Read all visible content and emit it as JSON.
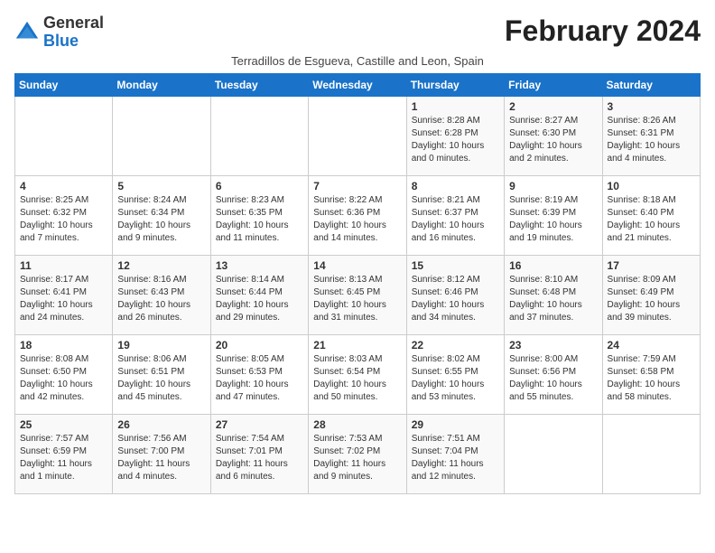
{
  "logo": {
    "general": "General",
    "blue": "Blue"
  },
  "header": {
    "month_title": "February 2024",
    "subtitle": "Terradillos de Esgueva, Castille and Leon, Spain"
  },
  "days_of_week": [
    "Sunday",
    "Monday",
    "Tuesday",
    "Wednesday",
    "Thursday",
    "Friday",
    "Saturday"
  ],
  "weeks": [
    [
      {
        "day": "",
        "info": ""
      },
      {
        "day": "",
        "info": ""
      },
      {
        "day": "",
        "info": ""
      },
      {
        "day": "",
        "info": ""
      },
      {
        "day": "1",
        "info": "Sunrise: 8:28 AM\nSunset: 6:28 PM\nDaylight: 10 hours and 0 minutes."
      },
      {
        "day": "2",
        "info": "Sunrise: 8:27 AM\nSunset: 6:30 PM\nDaylight: 10 hours and 2 minutes."
      },
      {
        "day": "3",
        "info": "Sunrise: 8:26 AM\nSunset: 6:31 PM\nDaylight: 10 hours and 4 minutes."
      }
    ],
    [
      {
        "day": "4",
        "info": "Sunrise: 8:25 AM\nSunset: 6:32 PM\nDaylight: 10 hours and 7 minutes."
      },
      {
        "day": "5",
        "info": "Sunrise: 8:24 AM\nSunset: 6:34 PM\nDaylight: 10 hours and 9 minutes."
      },
      {
        "day": "6",
        "info": "Sunrise: 8:23 AM\nSunset: 6:35 PM\nDaylight: 10 hours and 11 minutes."
      },
      {
        "day": "7",
        "info": "Sunrise: 8:22 AM\nSunset: 6:36 PM\nDaylight: 10 hours and 14 minutes."
      },
      {
        "day": "8",
        "info": "Sunrise: 8:21 AM\nSunset: 6:37 PM\nDaylight: 10 hours and 16 minutes."
      },
      {
        "day": "9",
        "info": "Sunrise: 8:19 AM\nSunset: 6:39 PM\nDaylight: 10 hours and 19 minutes."
      },
      {
        "day": "10",
        "info": "Sunrise: 8:18 AM\nSunset: 6:40 PM\nDaylight: 10 hours and 21 minutes."
      }
    ],
    [
      {
        "day": "11",
        "info": "Sunrise: 8:17 AM\nSunset: 6:41 PM\nDaylight: 10 hours and 24 minutes."
      },
      {
        "day": "12",
        "info": "Sunrise: 8:16 AM\nSunset: 6:43 PM\nDaylight: 10 hours and 26 minutes."
      },
      {
        "day": "13",
        "info": "Sunrise: 8:14 AM\nSunset: 6:44 PM\nDaylight: 10 hours and 29 minutes."
      },
      {
        "day": "14",
        "info": "Sunrise: 8:13 AM\nSunset: 6:45 PM\nDaylight: 10 hours and 31 minutes."
      },
      {
        "day": "15",
        "info": "Sunrise: 8:12 AM\nSunset: 6:46 PM\nDaylight: 10 hours and 34 minutes."
      },
      {
        "day": "16",
        "info": "Sunrise: 8:10 AM\nSunset: 6:48 PM\nDaylight: 10 hours and 37 minutes."
      },
      {
        "day": "17",
        "info": "Sunrise: 8:09 AM\nSunset: 6:49 PM\nDaylight: 10 hours and 39 minutes."
      }
    ],
    [
      {
        "day": "18",
        "info": "Sunrise: 8:08 AM\nSunset: 6:50 PM\nDaylight: 10 hours and 42 minutes."
      },
      {
        "day": "19",
        "info": "Sunrise: 8:06 AM\nSunset: 6:51 PM\nDaylight: 10 hours and 45 minutes."
      },
      {
        "day": "20",
        "info": "Sunrise: 8:05 AM\nSunset: 6:53 PM\nDaylight: 10 hours and 47 minutes."
      },
      {
        "day": "21",
        "info": "Sunrise: 8:03 AM\nSunset: 6:54 PM\nDaylight: 10 hours and 50 minutes."
      },
      {
        "day": "22",
        "info": "Sunrise: 8:02 AM\nSunset: 6:55 PM\nDaylight: 10 hours and 53 minutes."
      },
      {
        "day": "23",
        "info": "Sunrise: 8:00 AM\nSunset: 6:56 PM\nDaylight: 10 hours and 55 minutes."
      },
      {
        "day": "24",
        "info": "Sunrise: 7:59 AM\nSunset: 6:58 PM\nDaylight: 10 hours and 58 minutes."
      }
    ],
    [
      {
        "day": "25",
        "info": "Sunrise: 7:57 AM\nSunset: 6:59 PM\nDaylight: 11 hours and 1 minute."
      },
      {
        "day": "26",
        "info": "Sunrise: 7:56 AM\nSunset: 7:00 PM\nDaylight: 11 hours and 4 minutes."
      },
      {
        "day": "27",
        "info": "Sunrise: 7:54 AM\nSunset: 7:01 PM\nDaylight: 11 hours and 6 minutes."
      },
      {
        "day": "28",
        "info": "Sunrise: 7:53 AM\nSunset: 7:02 PM\nDaylight: 11 hours and 9 minutes."
      },
      {
        "day": "29",
        "info": "Sunrise: 7:51 AM\nSunset: 7:04 PM\nDaylight: 11 hours and 12 minutes."
      },
      {
        "day": "",
        "info": ""
      },
      {
        "day": "",
        "info": ""
      }
    ]
  ]
}
